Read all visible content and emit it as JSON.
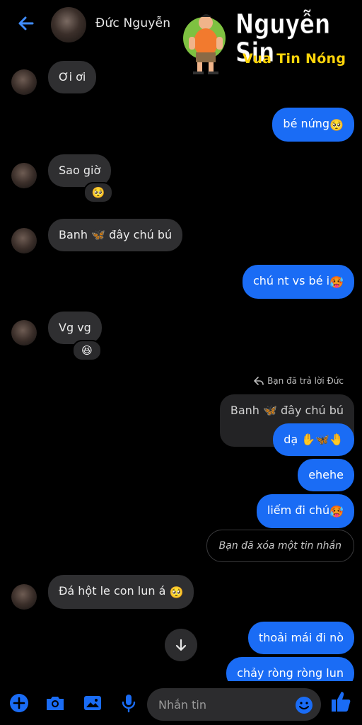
{
  "header": {
    "contact_name": "Đức Nguyễn"
  },
  "watermark": {
    "title": "Nguyễn Sin",
    "subtitle": "Vua Tin Nóng"
  },
  "messages": [
    {
      "side": "in",
      "text": "Ơi ơi"
    },
    {
      "side": "out",
      "text": "bé nứng",
      "emoji": "🥺"
    },
    {
      "side": "in",
      "text": "Sao giờ",
      "reaction": "🥺"
    },
    {
      "side": "in",
      "text": "Banh 🦋 đây chú bú"
    },
    {
      "side": "out",
      "text": "chú nt vs bé i",
      "emoji": "🥵"
    },
    {
      "side": "in",
      "text": "Vg vg",
      "reaction": "😆"
    },
    {
      "side": "out",
      "text": "dạ ✋🦋🤚",
      "reply_label": "Bạn đã trả lời Đức",
      "quoted": "Banh 🦋 đây chú bú"
    },
    {
      "side": "out",
      "text": "ehehe"
    },
    {
      "side": "out",
      "text": "liếm đi chú",
      "emoji": "🥵"
    },
    {
      "side": "out",
      "text": "Bạn đã xóa một tin nhắn",
      "deleted": true
    },
    {
      "side": "in",
      "text": "Đá hột le con lun á ",
      "emoji": "🥺"
    },
    {
      "side": "out",
      "text": "thoải mái đi nò"
    },
    {
      "side": "out",
      "text": "chảy ròng ròng lun"
    }
  ],
  "composer": {
    "placeholder": "Nhắn tin"
  },
  "colors": {
    "accent": "#1a6cf5",
    "incoming_bubble": "#2f2f31",
    "background": "#000000",
    "watermark_sub": "#ffd40a"
  },
  "icons": [
    "back-arrow-icon",
    "plus-icon",
    "camera-icon",
    "gallery-icon",
    "microphone-icon",
    "emoji-icon",
    "like-icon",
    "arrow-down-icon",
    "reply-icon"
  ]
}
